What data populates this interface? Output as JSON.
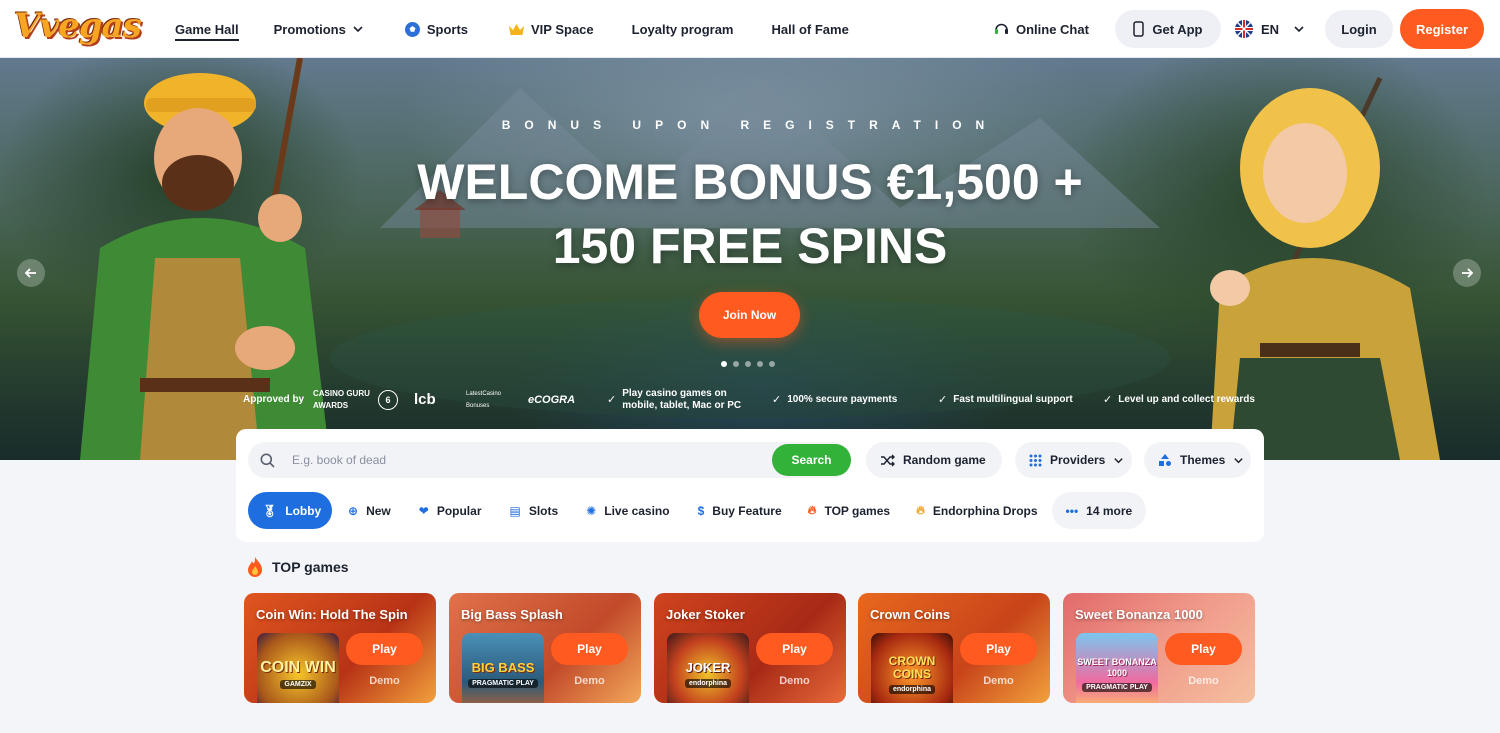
{
  "brand": {
    "logo_text": "Vvegas"
  },
  "nav": {
    "items": [
      {
        "label": "Game Hall",
        "icon": "",
        "active": true
      },
      {
        "label": "Promotions",
        "icon": "chevron-down-icon"
      },
      {
        "label": "Sports",
        "icon": "soccer-ball-icon"
      },
      {
        "label": "VIP Space",
        "icon": "crown-icon"
      },
      {
        "label": "Loyalty program"
      },
      {
        "label": "Hall of Fame"
      }
    ]
  },
  "header_right": {
    "chat_label": "Online Chat",
    "get_app_label": "Get App",
    "language": "EN",
    "login_label": "Login",
    "register_label": "Register"
  },
  "hero": {
    "kicker": "BONUS UPON REGISTRATION",
    "title_line1": "WELCOME BONUS €1,500 +",
    "title_line2": "150 FREE SPINS",
    "cta_label": "Join Now",
    "slide_count": 5,
    "active_slide": 1,
    "approved_by": "Approved by",
    "partners": [
      "CASINO GURU AWARDS",
      "6",
      "lcb",
      "LatestCasino Bonuses",
      "eCOGRA"
    ],
    "features": [
      "Play casino games on mobile, tablet, Mac or PC",
      "100% secure payments",
      "Fast multilingual support",
      "Level up and collect rewards"
    ]
  },
  "search": {
    "placeholder": "E.g. book of dead",
    "value": "",
    "button_label": "Search",
    "random_label": "Random game",
    "providers_label": "Providers",
    "themes_label": "Themes"
  },
  "categories": [
    {
      "label": "Lobby",
      "icon": "medal-icon",
      "active": true
    },
    {
      "label": "New",
      "icon": "plus-circle-icon"
    },
    {
      "label": "Popular",
      "icon": "heart-icon"
    },
    {
      "label": "Slots",
      "icon": "slot-machine-icon"
    },
    {
      "label": "Live casino",
      "icon": "live-icon"
    },
    {
      "label": "Buy Feature",
      "icon": "dollar-icon"
    },
    {
      "label": "TOP games",
      "icon": "fire-icon"
    },
    {
      "label": "Endorphina Drops",
      "icon": "drops-icon"
    },
    {
      "label": "14 more",
      "icon": "more-dots-icon"
    }
  ],
  "top_games": {
    "title": "TOP games",
    "play_label": "Play",
    "demo_label": "Demo",
    "games": [
      {
        "title": "Coin Win: Hold The Spin",
        "thumb_text": "COIN WIN",
        "provider": "GAMZIX",
        "color": "#c7441a"
      },
      {
        "title": "Big Bass Splash",
        "thumb_text": "BIG BASS",
        "provider": "PRAGMATIC PLAY",
        "color": "#d06a3c"
      },
      {
        "title": "Joker Stoker",
        "thumb_text": "JOKER",
        "provider": "endorphina",
        "color": "#c23a1c"
      },
      {
        "title": "Crown Coins",
        "thumb_text": "CROWN COINS",
        "provider": "endorphina",
        "color": "#d2561c"
      },
      {
        "title": "Sweet Bonanza 1000",
        "thumb_text": "SWEET BONANZA 1000",
        "provider": "PRAGMATIC PLAY",
        "color": "#d65a5a"
      }
    ]
  }
}
